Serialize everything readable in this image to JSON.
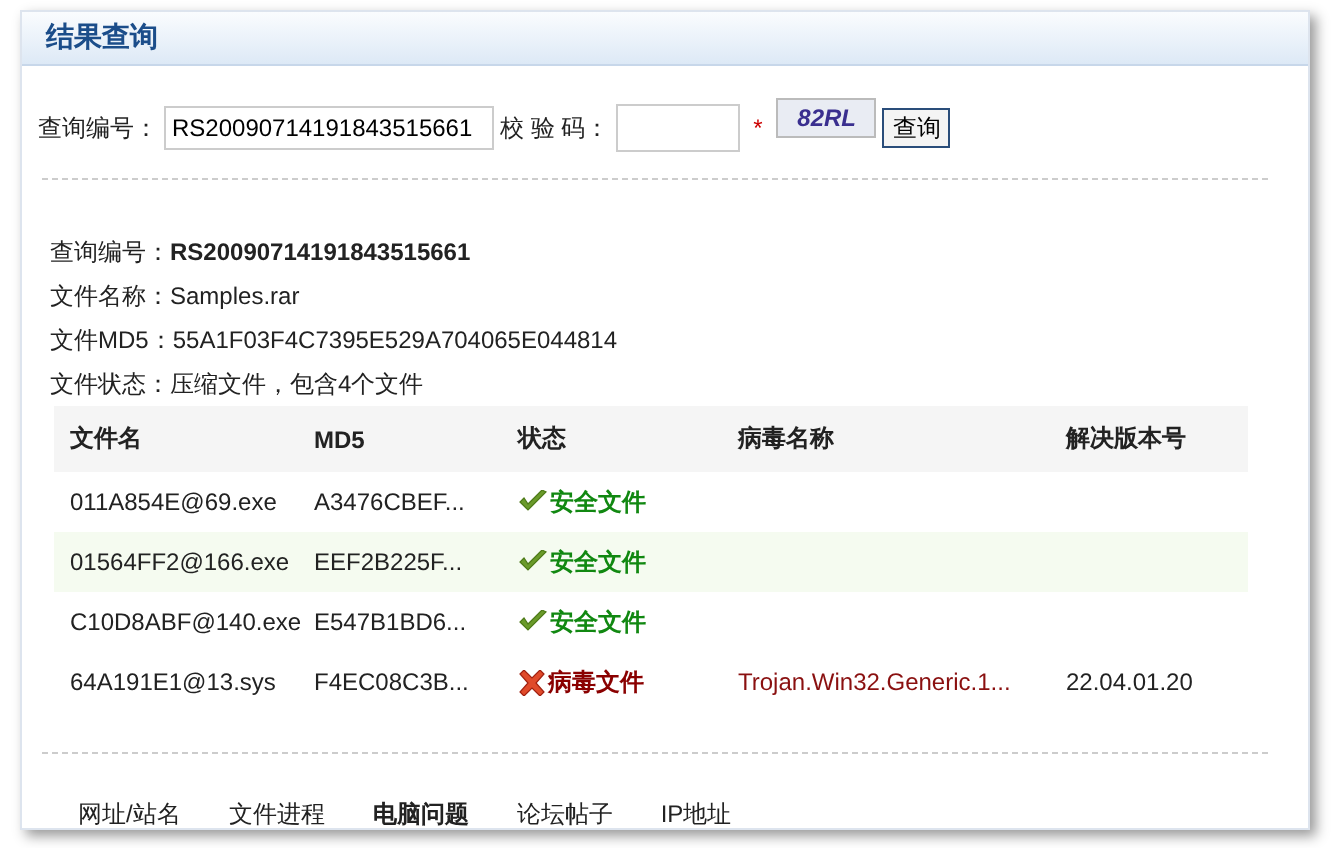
{
  "title": "结果查询",
  "form": {
    "query_label": "查询编号：",
    "query_value": "RS20090714191843515661",
    "code_label": "校 验 码：",
    "required_mark": "*",
    "captcha": "82RL",
    "submit": "查询"
  },
  "info": [
    {
      "label": "查询编号：",
      "value": "RS20090714191843515661",
      "bold": true
    },
    {
      "label": "文件名称：",
      "value": "Samples.rar",
      "bold": false
    },
    {
      "label": "文件MD5：",
      "value": "55A1F03F4C7395E529A704065E044814",
      "bold": false
    },
    {
      "label": "文件状态：",
      "value": "压缩文件，包含4个文件",
      "bold": false
    }
  ],
  "table": {
    "columns": [
      "文件名",
      "MD5",
      "状态",
      "病毒名称",
      "解决版本号"
    ],
    "rows": [
      {
        "name": "011A854E@69.exe",
        "md5": "A3476CBEF...",
        "kind": "safe",
        "status": "安全文件",
        "highlighted": false
      },
      {
        "name": "01564FF2@166.exe",
        "md5": "EEF2B225F...",
        "kind": "safe",
        "status": "安全文件",
        "highlighted": true
      },
      {
        "name": "C10D8ABF@140.exe",
        "md5": "E547B1BD6...",
        "kind": "safe",
        "status": "安全文件",
        "highlighted": false
      },
      {
        "name": "64A191E1@13.sys",
        "md5": "F4EC08C3B...",
        "kind": "virus",
        "status": "病毒文件",
        "virus": "Trojan.Win32.Generic.1...",
        "version": "22.04.01.20",
        "highlighted": false
      }
    ]
  },
  "tabs": [
    {
      "label": "网址/站名",
      "selected": false
    },
    {
      "label": "文件进程",
      "selected": false
    },
    {
      "label": "电脑问题",
      "selected": true
    },
    {
      "label": "论坛帖子",
      "selected": false
    },
    {
      "label": "IP地址",
      "selected": false
    }
  ]
}
